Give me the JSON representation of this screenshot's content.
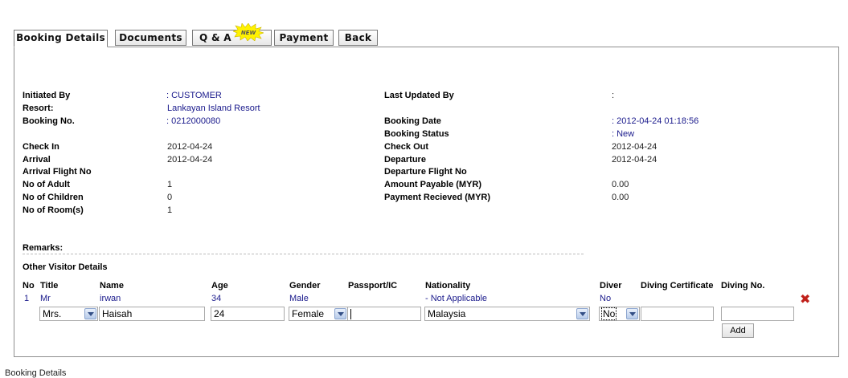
{
  "tabs": [
    {
      "label": "Booking Details"
    },
    {
      "label": "Documents"
    },
    {
      "label": "Q & A",
      "badge": "NEW"
    },
    {
      "label": "Payment"
    },
    {
      "label": "Back"
    }
  ],
  "details": {
    "initiated_by_label": "Initiated By",
    "initiated_by_value": ": CUSTOMER",
    "resort_label": "Resort:",
    "resort_value": "Lankayan Island Resort",
    "booking_no_label": "Booking No.",
    "booking_no_value": ": 0212000080",
    "check_in_label": "Check In",
    "check_in_value": "2012-04-24",
    "arrival_label": "Arrival",
    "arrival_value": "2012-04-24",
    "arrival_flight_label": "Arrival Flight No",
    "adult_label": "No of Adult",
    "adult_value": "1",
    "children_label": "No of Children",
    "children_value": "0",
    "rooms_label": "No of Room(s)",
    "rooms_value": "1",
    "last_updated_label": "Last Updated By",
    "last_updated_value": ":",
    "booking_date_label": "Booking Date",
    "booking_date_value": ": 2012-04-24 01:18:56",
    "booking_status_label": "Booking Status",
    "booking_status_value": ": New",
    "check_out_label": "Check Out",
    "check_out_value": "2012-04-24",
    "departure_label": "Departure",
    "departure_value": "2012-04-24",
    "departure_flight_label": "Departure Flight No",
    "amount_payable_label": "Amount Payable (MYR)",
    "amount_payable_value": "0.00",
    "payment_received_label": "Payment Recieved (MYR)",
    "payment_received_value": "0.00",
    "remarks_label": "Remarks:"
  },
  "visitors": {
    "section_title": "Other Visitor Details",
    "columns": [
      "No",
      "Title",
      "Name",
      "Age",
      "Gender",
      "Passport/IC",
      "Nationality",
      "Diver",
      "Diving Certificate",
      "Diving No."
    ],
    "rows": [
      {
        "no": "1",
        "title": "Mr",
        "name": "irwan",
        "age": "34",
        "gender": "Male",
        "passport": "",
        "nationality": "- Not Applicable",
        "diver": "No"
      }
    ],
    "new_entry": {
      "title": "Mrs.",
      "name": "Haisah",
      "age": "24",
      "gender": "Female",
      "passport": "",
      "nationality": "Malaysia",
      "diver": "No",
      "diving_certificate": "",
      "diving_no": ""
    },
    "add_label": "Add",
    "delete_icon": "red-x-icon"
  },
  "footer_text": "Booking Details",
  "colors": {
    "link_blue": "#1a1a8c",
    "delete_red": "#c0201a"
  }
}
